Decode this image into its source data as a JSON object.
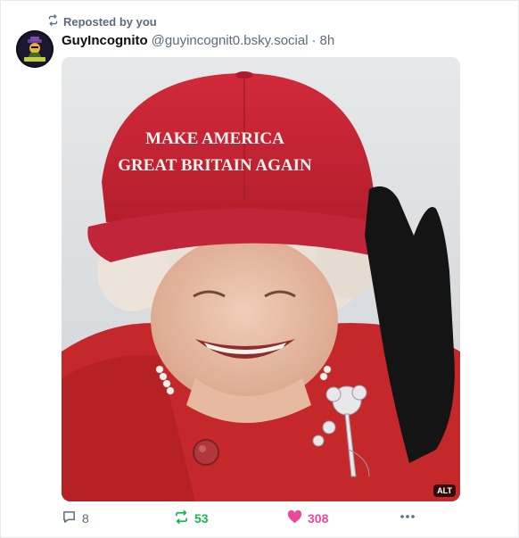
{
  "repost": {
    "label": "Reposted by you",
    "icon": "repost-icon"
  },
  "post": {
    "author_name": "GuyIncognito",
    "handle": "@guyincognit0.bsky.social",
    "separator": "·",
    "time": "8h",
    "image": {
      "hat_line1": "MAKE AMERICA",
      "hat_line2": "GREAT BRITAIN AGAIN",
      "alt_badge": "ALT"
    }
  },
  "actions": {
    "reply_count": "8",
    "repost_count": "53",
    "like_count": "308",
    "repost_color": "#13b84d",
    "like_color": "#ec4899"
  }
}
